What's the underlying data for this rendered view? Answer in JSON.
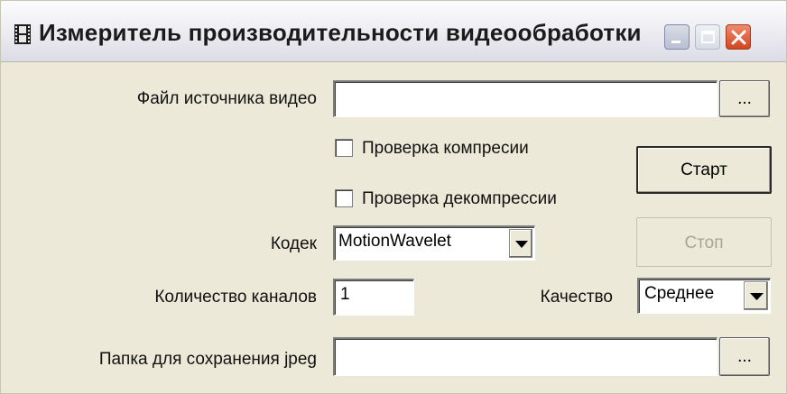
{
  "window": {
    "title": "Измеритель производительности видеообработки",
    "title_icon": "film-strip-icon",
    "controls": {
      "minimize_icon": "minimize-icon",
      "maximize_icon": "maximize-icon",
      "close_icon": "close-icon"
    }
  },
  "form": {
    "source_file": {
      "label": "Файл источника видео",
      "value": "",
      "browse_label": "..."
    },
    "check_compression": {
      "label": "Проверка компресии",
      "checked": false
    },
    "check_decompression": {
      "label": "Проверка декомпрессии",
      "checked": false
    },
    "codec": {
      "label": "Кодек",
      "selected": "MotionWavelet"
    },
    "channels": {
      "label": "Количество каналов",
      "value": "1"
    },
    "quality": {
      "label": "Качество",
      "selected": "Среднее"
    },
    "jpeg_folder": {
      "label": "Папка для сохранения jpeg",
      "value": "",
      "browse_label": "..."
    }
  },
  "buttons": {
    "start": "Старт",
    "stop": "Стоп"
  },
  "colors": {
    "dialog_bg": "#ece9d8",
    "close_button": "#d2461e",
    "disabled_text": "#a7a595"
  }
}
